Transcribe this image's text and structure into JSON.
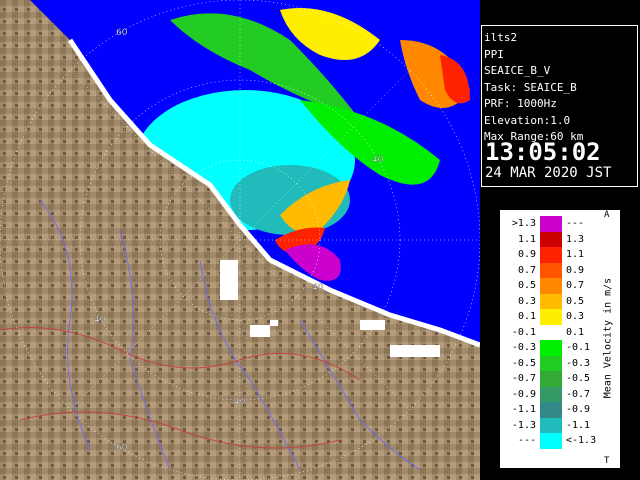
{
  "radar": {
    "site": "ilts2",
    "product": "PPI",
    "name": "SEAICE_B_V",
    "task": "Task: SEAICE_B",
    "prf": "PRF: 1000Hz",
    "elevation": "Elevation:1.0",
    "max_range": "Max Range:60 km",
    "time": "13:05:02",
    "date": "24 MAR 2020 JST"
  },
  "range_labels": {
    "top": "60",
    "upper_right": "40",
    "right": "40",
    "left": "40",
    "bottom": "40",
    "lower_left": "60"
  },
  "legend": {
    "title": "Mean Velocity in m/s",
    "corner_top": "A",
    "corner_bottom": "T",
    "rows": [
      {
        "lo": ">1.3",
        "hi": "---",
        "color": "#cc00cc"
      },
      {
        "lo": "1.1",
        "hi": "1.3",
        "color": "#cc0000"
      },
      {
        "lo": "0.9",
        "hi": "1.1",
        "color": "#ff2200"
      },
      {
        "lo": "0.7",
        "hi": "0.9",
        "color": "#ff5500"
      },
      {
        "lo": "0.5",
        "hi": "0.7",
        "color": "#ff8800"
      },
      {
        "lo": "0.3",
        "hi": "0.5",
        "color": "#ffbb00"
      },
      {
        "lo": "0.1",
        "hi": "0.3",
        "color": "#ffee00"
      },
      {
        "lo": "-0.1",
        "hi": "0.1",
        "color": "#ffffff"
      },
      {
        "lo": "-0.3",
        "hi": "-0.1",
        "color": "#00ee00"
      },
      {
        "lo": "-0.5",
        "hi": "-0.3",
        "color": "#22cc22"
      },
      {
        "lo": "-0.7",
        "hi": "-0.5",
        "color": "#33aa33"
      },
      {
        "lo": "-0.9",
        "hi": "-0.7",
        "color": "#339966"
      },
      {
        "lo": "-1.1",
        "hi": "-0.9",
        "color": "#338888"
      },
      {
        "lo": "-1.3",
        "hi": "-1.1",
        "color": "#22bbbb"
      },
      {
        "lo": "---",
        "hi": "<-1.3",
        "color": "#00ffff"
      }
    ]
  },
  "colors": {
    "sea": "#0000ff",
    "land": "#a08a6a",
    "panel": "#000000"
  }
}
